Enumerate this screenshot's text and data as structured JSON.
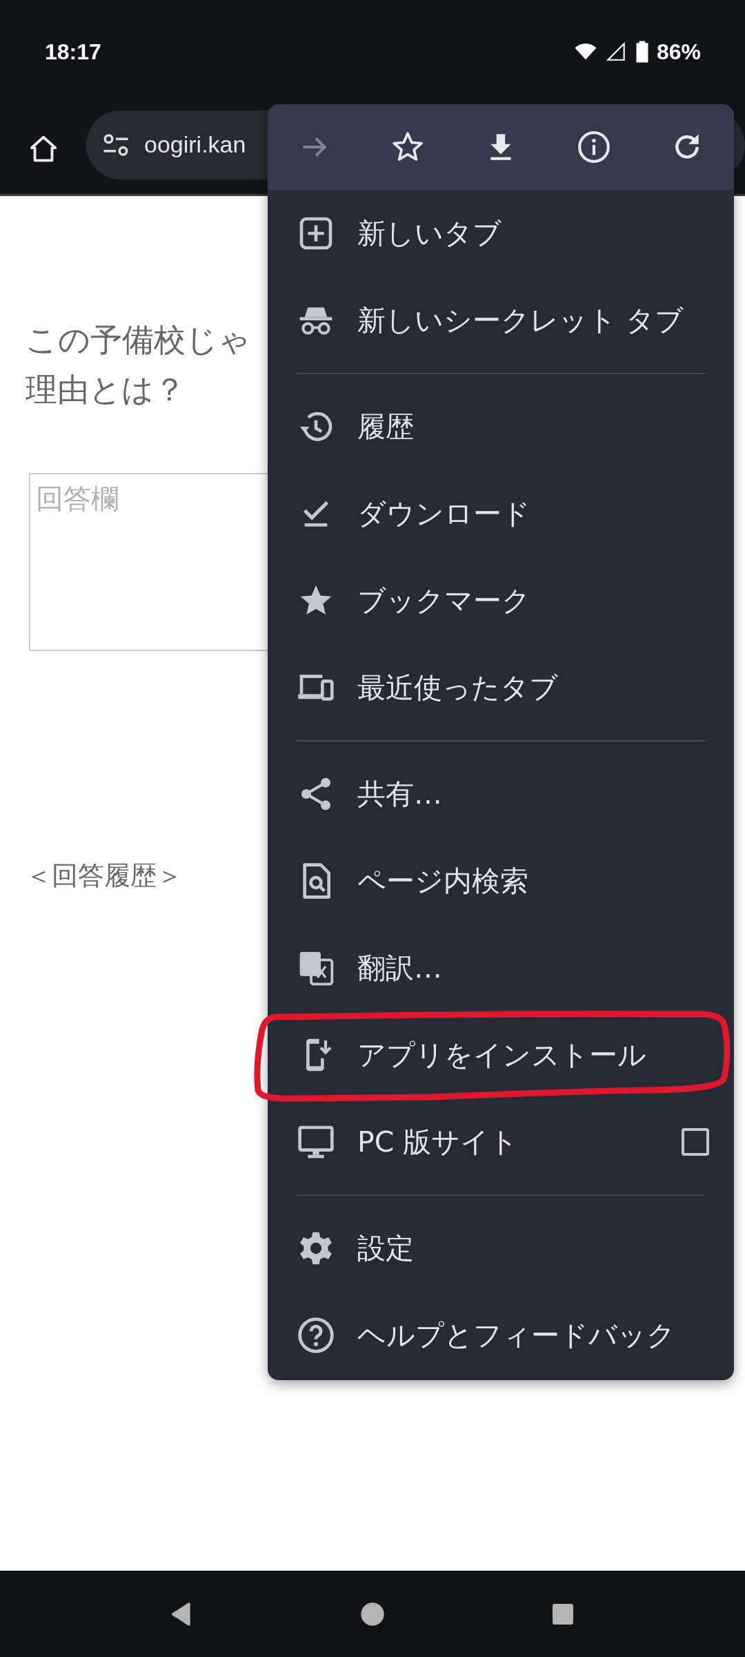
{
  "status_bar": {
    "time": "18:17",
    "battery": "86%"
  },
  "toolbar": {
    "url": "oogiri.kan"
  },
  "page": {
    "question_lines": [
      "この予備校じゃ",
      "理由とは？"
    ],
    "answer_field": {
      "placeholder": "回答欄"
    },
    "history_heading": "＜回答履歴＞"
  },
  "menu": {
    "top_icons": [
      {
        "kind": "forward",
        "disabled": true
      },
      {
        "kind": "star",
        "disabled": false
      },
      {
        "kind": "download",
        "disabled": false
      },
      {
        "kind": "info",
        "disabled": false
      },
      {
        "kind": "reload",
        "disabled": false
      }
    ],
    "sections": [
      [
        {
          "kind": "newtab",
          "label": "新しいタブ"
        },
        {
          "kind": "incognito",
          "label": "新しいシークレット タブ"
        }
      ],
      [
        {
          "kind": "history",
          "label": "履歴"
        },
        {
          "kind": "downloads",
          "label": "ダウンロード"
        },
        {
          "kind": "bookmarks",
          "label": "ブックマーク"
        },
        {
          "kind": "recent",
          "label": "最近使ったタブ"
        }
      ],
      [
        {
          "kind": "share",
          "label": "共有…"
        },
        {
          "kind": "find",
          "label": "ページ内検索"
        },
        {
          "kind": "translate",
          "label": "翻訳…"
        },
        {
          "kind": "install",
          "label": "アプリをインストール",
          "annotated": true
        },
        {
          "kind": "desktop",
          "label": "PC 版サイト",
          "checked": false
        }
      ],
      [
        {
          "kind": "settings",
          "label": "設定"
        },
        {
          "kind": "help",
          "label": "ヘルプとフィードバック"
        }
      ]
    ]
  }
}
